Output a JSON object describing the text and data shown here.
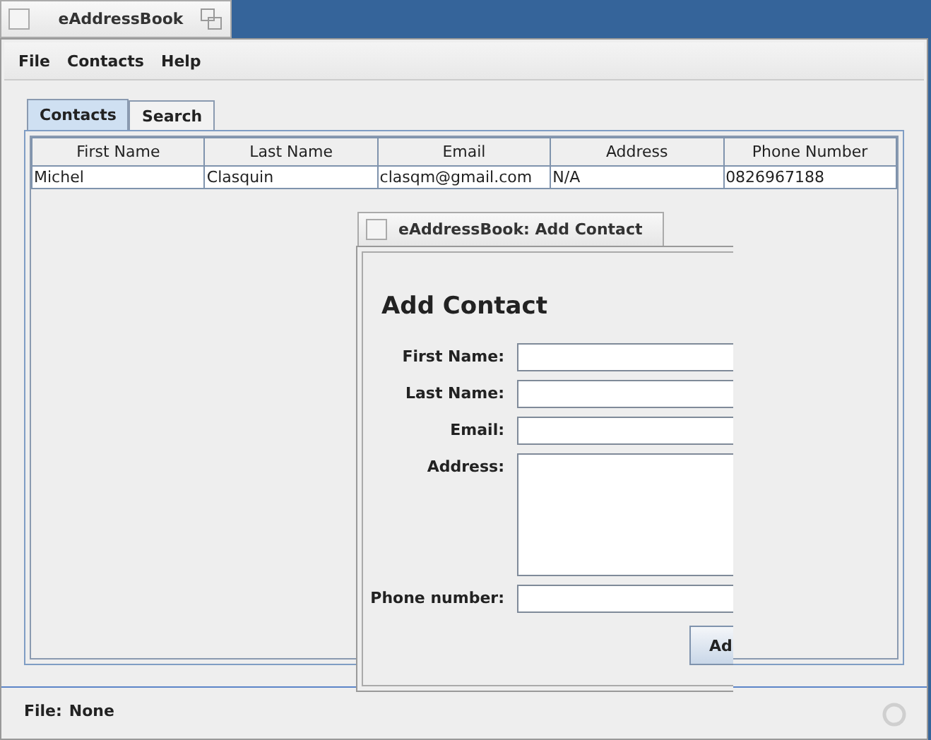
{
  "window": {
    "title": "eAddressBook"
  },
  "menu": [
    "File",
    "Contacts",
    "Help"
  ],
  "tabs": [
    {
      "label": "Contacts",
      "selected": true
    },
    {
      "label": "Search",
      "selected": false
    }
  ],
  "table": {
    "columns": [
      "First Name",
      "Last Name",
      "Email",
      "Address",
      "Phone Number"
    ],
    "rows": [
      [
        "Michel",
        "Clasquin",
        "clasqm@gmail.com",
        "N/A",
        "0826967188"
      ]
    ]
  },
  "status_bar": {
    "label": "File:",
    "value": "None"
  },
  "dialog": {
    "title": "eAddressBook: Add Contact",
    "heading": "Add Contact",
    "fields": [
      {
        "label": "First Name:",
        "kind": "line"
      },
      {
        "label": "Last Name:",
        "kind": "line"
      },
      {
        "label": "Email:",
        "kind": "line"
      },
      {
        "label": "Address:",
        "kind": "area"
      },
      {
        "label": "Phone number:",
        "kind": "line"
      }
    ],
    "button": "Ad"
  }
}
